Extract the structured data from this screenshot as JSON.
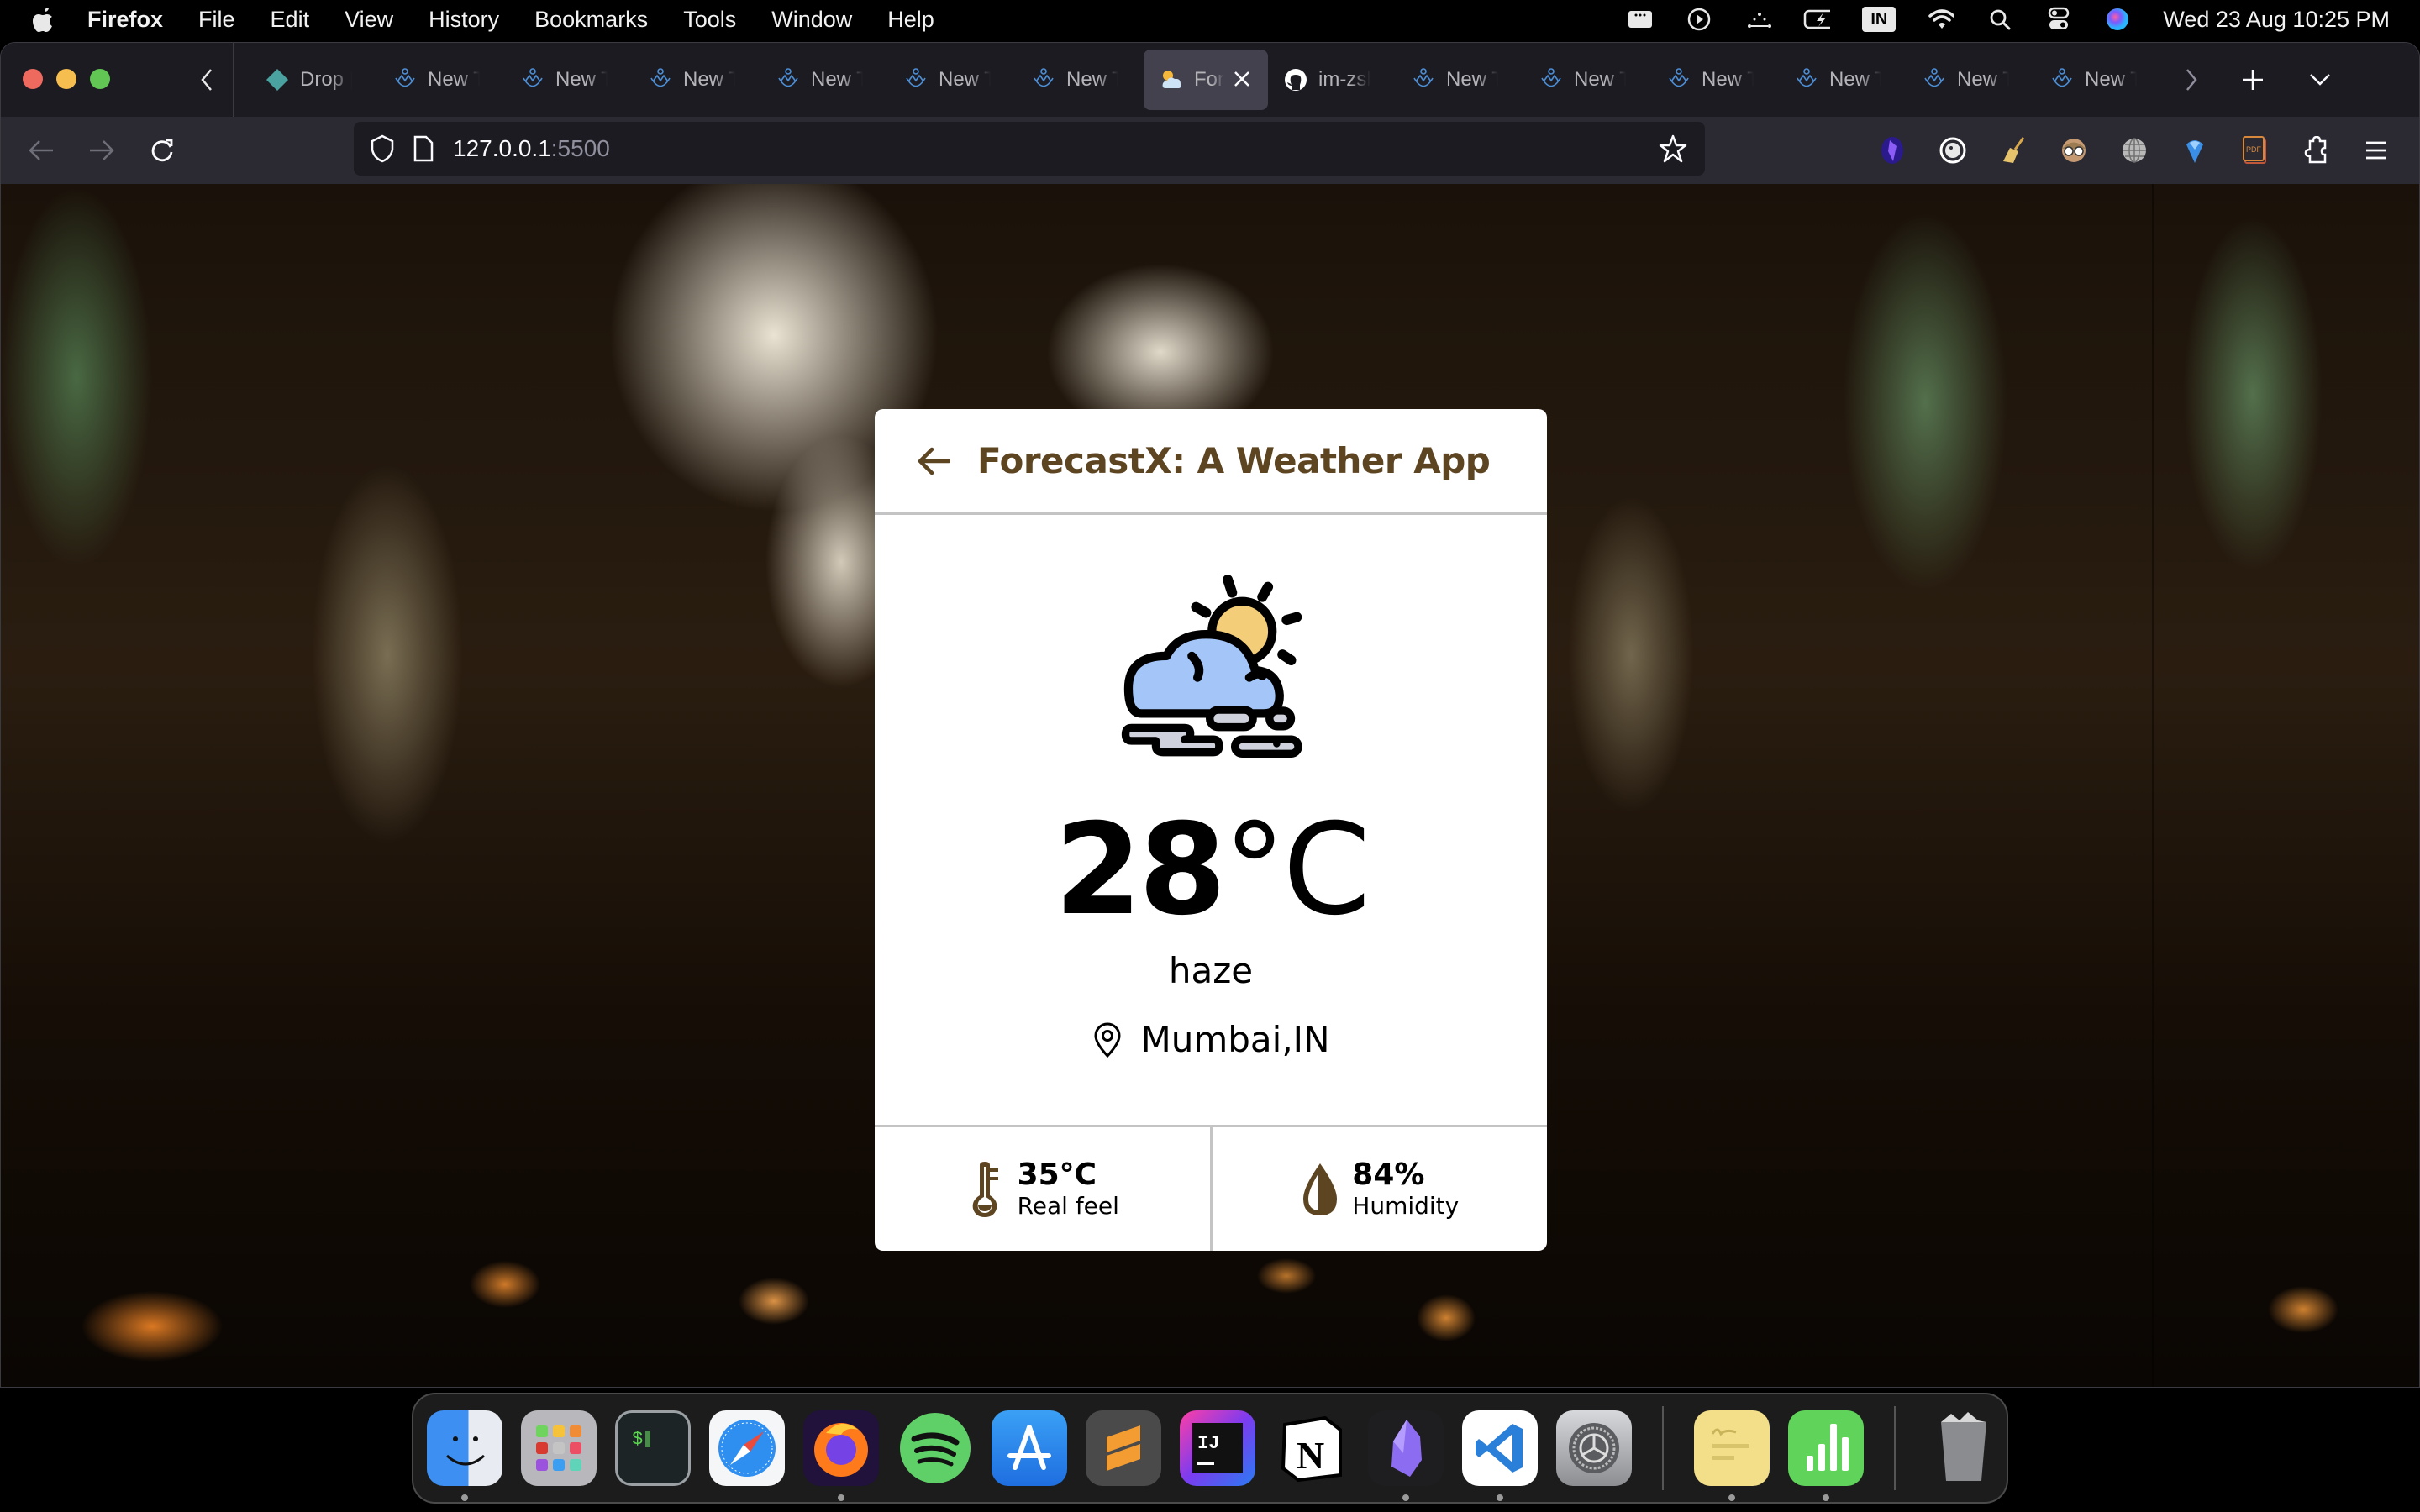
{
  "menubar": {
    "app_name": "Firefox",
    "items": [
      "File",
      "Edit",
      "View",
      "History",
      "Bookmarks",
      "Tools",
      "Window",
      "Help"
    ],
    "input_source": "IN",
    "clock": "Wed 23 Aug  10:25 PM",
    "status_icons": [
      "stage-manager-icon",
      "play-icon",
      "bluetooth-dots-icon",
      "battery-charging-icon",
      "input-source-icon",
      "wifi-icon",
      "spotlight-search-icon",
      "control-center-icon",
      "siri-icon"
    ]
  },
  "browser": {
    "tabs": [
      {
        "label": "Drop |",
        "icon": "dropbox-diamond-icon",
        "active": false
      },
      {
        "label": "New Tab",
        "icon": "new-tab-mountain-icon",
        "active": false
      },
      {
        "label": "New Tab",
        "icon": "new-tab-mountain-icon",
        "active": false
      },
      {
        "label": "New Tab",
        "icon": "new-tab-mountain-icon",
        "active": false
      },
      {
        "label": "New Tab",
        "icon": "new-tab-mountain-icon",
        "active": false
      },
      {
        "label": "New Tab",
        "icon": "new-tab-mountain-icon",
        "active": false
      },
      {
        "label": "New Tab",
        "icon": "new-tab-mountain-icon",
        "active": false
      },
      {
        "label": "ForecastX",
        "icon": "weather-favicon-icon",
        "active": true
      },
      {
        "label": "im-zsh",
        "icon": "github-icon",
        "active": false
      },
      {
        "label": "New Tab",
        "icon": "new-tab-mountain-icon",
        "active": false
      },
      {
        "label": "New Tab",
        "icon": "new-tab-mountain-icon",
        "active": false
      },
      {
        "label": "New Tab",
        "icon": "new-tab-mountain-icon",
        "active": false
      },
      {
        "label": "New Tab",
        "icon": "new-tab-mountain-icon",
        "active": false
      },
      {
        "label": "New Tab",
        "icon": "new-tab-mountain-icon",
        "active": false
      },
      {
        "label": "New Tab",
        "icon": "new-tab-mountain-icon",
        "active": false
      }
    ],
    "url_host": "127.0.0.1",
    "url_port": ":5500",
    "extensions": [
      "obsidian-crystal-extension-icon",
      "duckduckgo-extension-icon",
      "broom-cleaner-extension-icon",
      "glasses-avatar-extension-icon",
      "globe-extension-icon",
      "blue-gem-extension-icon",
      "pdf-extension-icon",
      "extensions-puzzle-icon",
      "hamburger-menu-icon"
    ]
  },
  "app": {
    "title": "ForecastX: A Weather App",
    "temperature": "28",
    "temperature_unit": "°C",
    "condition": "haze",
    "location": "Mumbai,IN",
    "real_feel": {
      "value": "35°C",
      "label": "Real feel"
    },
    "humidity": {
      "value": "84%",
      "label": "Humidity"
    },
    "accent_color": "#5e4522"
  },
  "dock": {
    "apps": [
      {
        "name": "Finder",
        "running": true
      },
      {
        "name": "Launchpad",
        "running": false
      },
      {
        "name": "Terminal",
        "running": false
      },
      {
        "name": "Safari",
        "running": false
      },
      {
        "name": "Firefox",
        "running": true
      },
      {
        "name": "Spotify",
        "running": false
      },
      {
        "name": "App Store",
        "running": false
      },
      {
        "name": "Sublime Text",
        "running": false
      },
      {
        "name": "IntelliJ IDEA",
        "running": false
      },
      {
        "name": "Notion",
        "running": false
      },
      {
        "name": "Obsidian",
        "running": true
      },
      {
        "name": "Visual Studio Code",
        "running": true
      },
      {
        "name": "System Settings",
        "running": false
      },
      {
        "name": "Stickies",
        "running": true
      },
      {
        "name": "Numbers",
        "running": true
      },
      {
        "name": "Trash",
        "running": false
      }
    ]
  }
}
